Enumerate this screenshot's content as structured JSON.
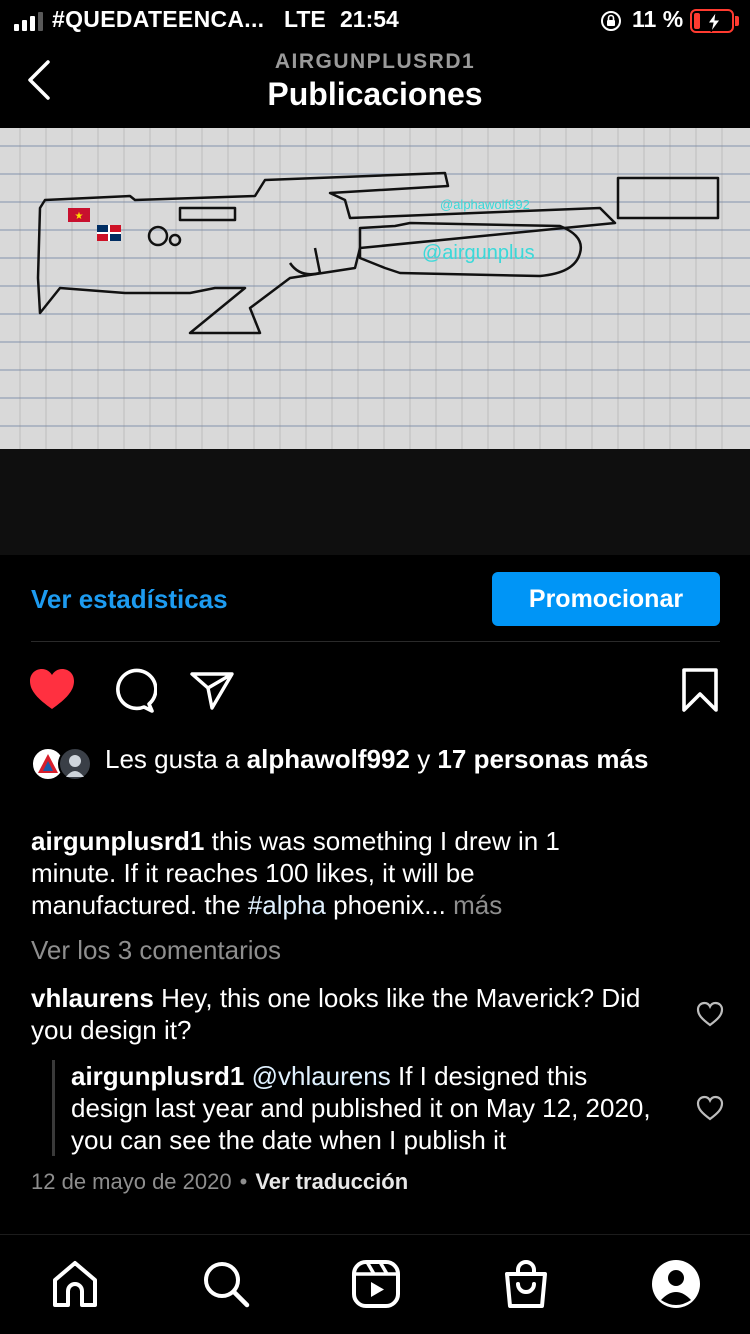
{
  "status_bar": {
    "carrier": "#QUEDATEENCA...",
    "network": "LTE",
    "time": "21:54",
    "battery": "11 %"
  },
  "header": {
    "account": "AIRGUNPLUSRD1",
    "title": "Publicaciones"
  },
  "media": {
    "watermark_1": "@alphawolf992",
    "watermark_2": "@airgunplus"
  },
  "insights": {
    "stats_label": "Ver estadísticas",
    "promote_label": "Promocionar"
  },
  "actions": {
    "liked": true,
    "like_color": "#ff3040"
  },
  "likes": {
    "prefix": "Les gusta a",
    "user": "alphawolf992",
    "conj": "y",
    "others": "17 personas",
    "others_more": "más"
  },
  "caption": {
    "user": "airgunplusrd1",
    "text": "this was something I drew in 1 minute.  If it reaches 100 likes, it will be manufactured.  the",
    "hashtag": "#alpha",
    "text2": "phoenix...",
    "more": "más"
  },
  "comments": {
    "view_all": "Ver los 3 comentarios",
    "items": [
      {
        "user": "vhlaurens",
        "text": "Hey, this one looks like the Maverick? Did you design it?"
      },
      {
        "user": "airgunplusrd1",
        "mention": "@vhlaurens",
        "text": "If I designed this design last year and published it on May 12, 2020, you can see the date when I publish it"
      }
    ]
  },
  "meta": {
    "date": "12 de mayo de 2020",
    "separator": "•",
    "translate": "Ver traducción"
  },
  "colors": {
    "accent": "#0095f6",
    "link": "#1d9bf0",
    "muted": "#8e8e8e"
  }
}
